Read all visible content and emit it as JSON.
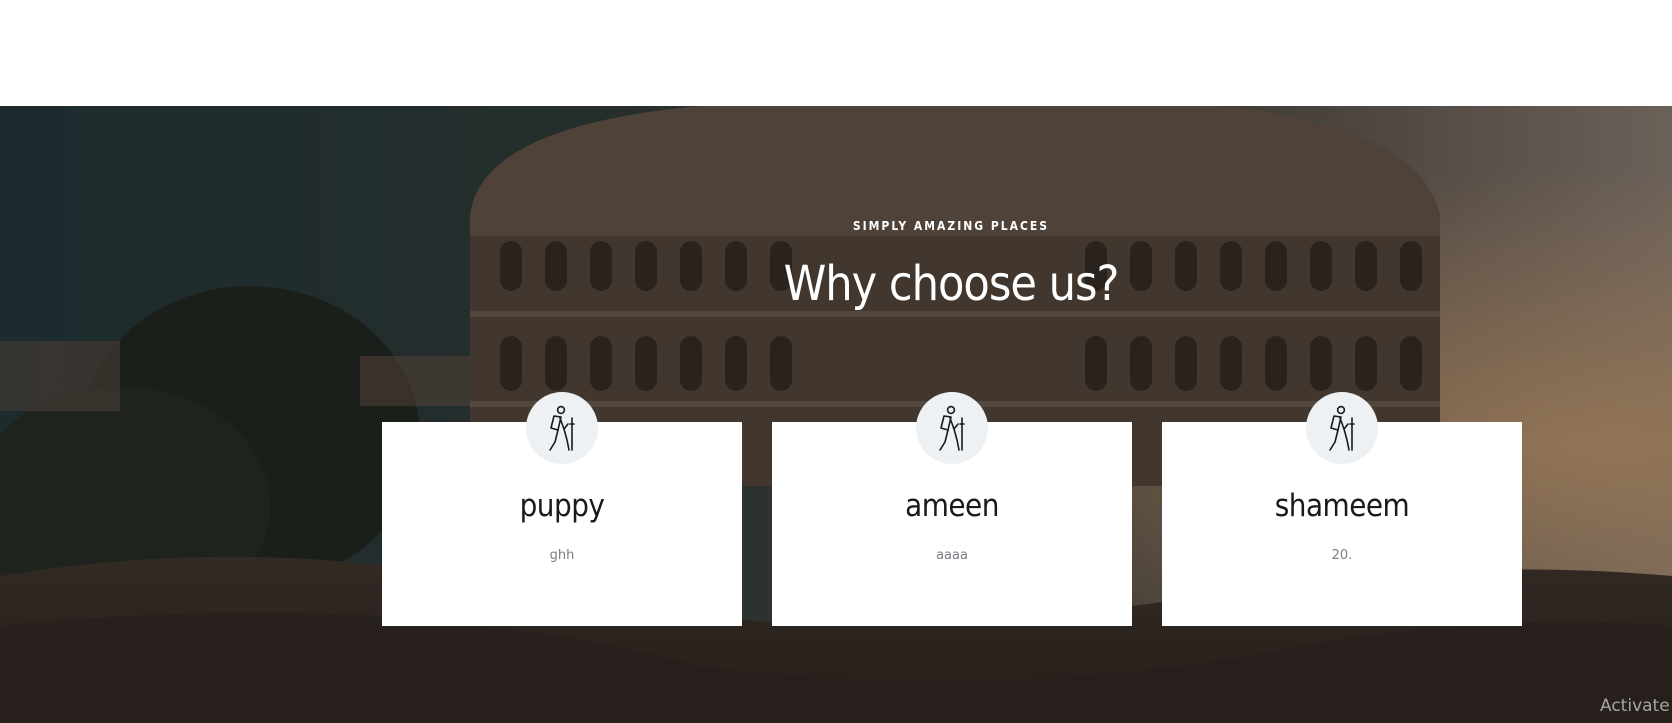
{
  "section": {
    "eyebrow": "SIMPLY AMAZING PLACES",
    "title": "Why choose us?"
  },
  "cards": [
    {
      "title": "puppy",
      "text": "ghh",
      "icon": "hiker-icon"
    },
    {
      "title": "ameen",
      "text": "aaaa",
      "icon": "hiker-icon"
    },
    {
      "title": "shameem",
      "text": "20.",
      "icon": "hiker-icon"
    }
  ],
  "watermark": "Activate",
  "colors": {
    "card_background": "#ffffff",
    "icon_circle": "#eef1f3",
    "heading_text": "#ffffff",
    "card_title": "#1a1a1a",
    "card_text": "#7a7f85"
  }
}
